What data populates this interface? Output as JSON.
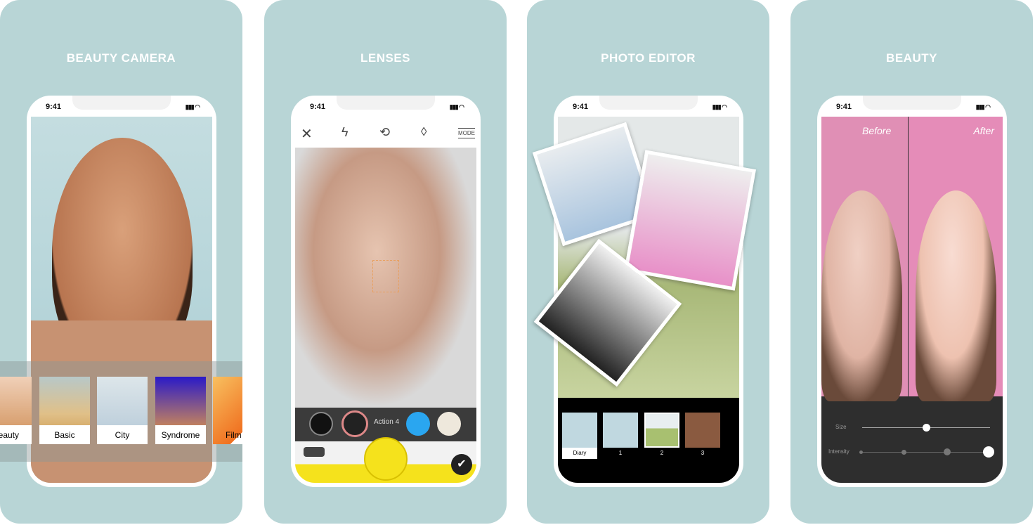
{
  "panels": [
    {
      "title": "BEAUTY CAMERA",
      "time": "9:41",
      "filters": [
        "eauty",
        "Basic",
        "City",
        "Syndrome",
        "Film"
      ]
    },
    {
      "title": "LENSES",
      "time": "9:41",
      "toolbar": [
        "close-icon",
        "flash-auto-icon",
        "switch-camera-icon",
        "no-filter-icon",
        "MODE"
      ],
      "lens_label": "Action 4"
    },
    {
      "title": "PHOTO EDITOR",
      "time": "9:41",
      "templates": [
        "Diary",
        "1",
        "2",
        "3"
      ]
    },
    {
      "title": "BEAUTY",
      "time": "9:41",
      "before": "Before",
      "after": "After",
      "sliders": {
        "size_label": "Size",
        "size_value": 0.5,
        "intensity_label": "Intensity",
        "intensity_level": 4,
        "intensity_steps": 4
      }
    }
  ],
  "colors": {
    "background": "#b8d5d6",
    "beauty_pink": "#e08fb5",
    "lens_yellow": "#f5e21c"
  }
}
